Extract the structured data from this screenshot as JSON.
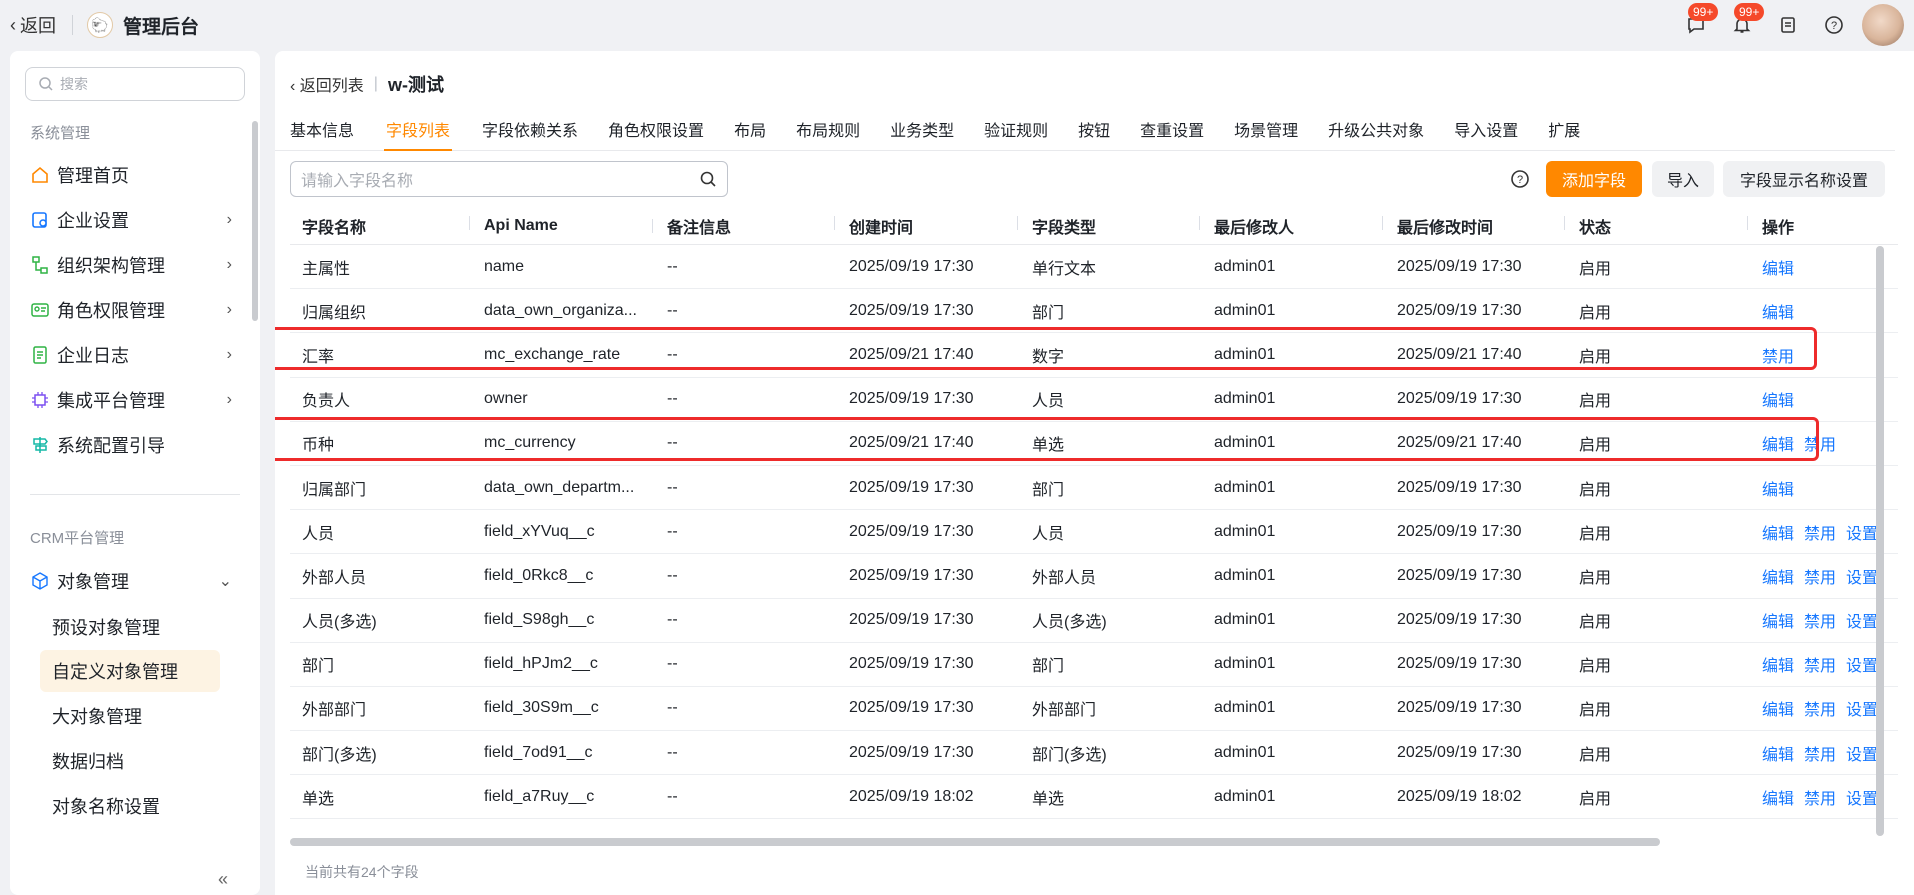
{
  "topbar": {
    "back_label": "返回",
    "app_title": "管理后台",
    "chat_badge": "99+",
    "bell_badge": "99+"
  },
  "sidebar": {
    "search_placeholder": "搜索",
    "group1_title": "系统管理",
    "items": [
      {
        "label": "管理首页"
      },
      {
        "label": "企业设置"
      },
      {
        "label": "组织架构管理"
      },
      {
        "label": "角色权限管理"
      },
      {
        "label": "企业日志"
      },
      {
        "label": "集成平台管理"
      },
      {
        "label": "系统配置引导"
      }
    ],
    "group2_title": "CRM平台管理",
    "object_menu": "对象管理",
    "sub_items": [
      {
        "label": "预设对象管理"
      },
      {
        "label": "自定义对象管理"
      },
      {
        "label": "大对象管理"
      },
      {
        "label": "数据归档"
      },
      {
        "label": "对象名称设置"
      }
    ],
    "collapse_icon": "«"
  },
  "main": {
    "back_list_label": "返回列表",
    "object_name": "w-测试",
    "tabs": [
      {
        "label": "基本信息"
      },
      {
        "label": "字段列表"
      },
      {
        "label": "字段依赖关系"
      },
      {
        "label": "角色权限设置"
      },
      {
        "label": "布局"
      },
      {
        "label": "布局规则"
      },
      {
        "label": "业务类型"
      },
      {
        "label": "验证规则"
      },
      {
        "label": "按钮"
      },
      {
        "label": "查重设置"
      },
      {
        "label": "场景管理"
      },
      {
        "label": "升级公共对象"
      },
      {
        "label": "导入设置"
      },
      {
        "label": "扩展"
      }
    ],
    "active_tab": "字段列表",
    "search_placeholder": "请输入字段名称",
    "add_field_button": "添加字段",
    "import_button": "导入",
    "display_name_button": "字段显示名称设置",
    "footer_text": "当前共有24个字段"
  },
  "table": {
    "columns": [
      "字段名称",
      "Api Name",
      "备注信息",
      "创建时间",
      "字段类型",
      "最后修改人",
      "最后修改时间",
      "状态",
      "操作"
    ],
    "rows": [
      {
        "name": "主属性",
        "api": "name",
        "note": "--",
        "created": "2025/09/19 17:30",
        "type": "单行文本",
        "modifier": "admin01",
        "modified": "2025/09/19 17:30",
        "status": "启用",
        "ops": [
          "编辑"
        ]
      },
      {
        "name": "归属组织",
        "api": "data_own_organiza...",
        "note": "--",
        "created": "2025/09/19 17:30",
        "type": "部门",
        "modifier": "admin01",
        "modified": "2025/09/19 17:30",
        "status": "启用",
        "ops": [
          "编辑"
        ]
      },
      {
        "name": "汇率",
        "api": "mc_exchange_rate",
        "note": "--",
        "created": "2025/09/21 17:40",
        "type": "数字",
        "modifier": "admin01",
        "modified": "2025/09/21 17:40",
        "status": "启用",
        "ops": [
          "禁用"
        ]
      },
      {
        "name": "负责人",
        "api": "owner",
        "note": "--",
        "created": "2025/09/19 17:30",
        "type": "人员",
        "modifier": "admin01",
        "modified": "2025/09/19 17:30",
        "status": "启用",
        "ops": [
          "编辑"
        ]
      },
      {
        "name": "币种",
        "api": "mc_currency",
        "note": "--",
        "created": "2025/09/21 17:40",
        "type": "单选",
        "modifier": "admin01",
        "modified": "2025/09/21 17:40",
        "status": "启用",
        "ops": [
          "编辑",
          "禁用"
        ]
      },
      {
        "name": "归属部门",
        "api": "data_own_departm...",
        "note": "--",
        "created": "2025/09/19 17:30",
        "type": "部门",
        "modifier": "admin01",
        "modified": "2025/09/19 17:30",
        "status": "启用",
        "ops": [
          "编辑"
        ]
      },
      {
        "name": "人员",
        "api": "field_xYVuq__c",
        "note": "--",
        "created": "2025/09/19 17:30",
        "type": "人员",
        "modifier": "admin01",
        "modified": "2025/09/19 17:30",
        "status": "启用",
        "ops": [
          "编辑",
          "禁用",
          "设置"
        ]
      },
      {
        "name": "外部人员",
        "api": "field_0Rkc8__c",
        "note": "--",
        "created": "2025/09/19 17:30",
        "type": "外部人员",
        "modifier": "admin01",
        "modified": "2025/09/19 17:30",
        "status": "启用",
        "ops": [
          "编辑",
          "禁用",
          "设置"
        ]
      },
      {
        "name": "人员(多选)",
        "api": "field_S98gh__c",
        "note": "--",
        "created": "2025/09/19 17:30",
        "type": "人员(多选)",
        "modifier": "admin01",
        "modified": "2025/09/19 17:30",
        "status": "启用",
        "ops": [
          "编辑",
          "禁用",
          "设置"
        ]
      },
      {
        "name": "部门",
        "api": "field_hPJm2__c",
        "note": "--",
        "created": "2025/09/19 17:30",
        "type": "部门",
        "modifier": "admin01",
        "modified": "2025/09/19 17:30",
        "status": "启用",
        "ops": [
          "编辑",
          "禁用",
          "设置"
        ]
      },
      {
        "name": "外部部门",
        "api": "field_30S9m__c",
        "note": "--",
        "created": "2025/09/19 17:30",
        "type": "外部部门",
        "modifier": "admin01",
        "modified": "2025/09/19 17:30",
        "status": "启用",
        "ops": [
          "编辑",
          "禁用",
          "设置"
        ]
      },
      {
        "name": "部门(多选)",
        "api": "field_7od91__c",
        "note": "--",
        "created": "2025/09/19 17:30",
        "type": "部门(多选)",
        "modifier": "admin01",
        "modified": "2025/09/19 17:30",
        "status": "启用",
        "ops": [
          "编辑",
          "禁用",
          "设置"
        ]
      },
      {
        "name": "单选",
        "api": "field_a7Ruy__c",
        "note": "--",
        "created": "2025/09/19 18:02",
        "type": "单选",
        "modifier": "admin01",
        "modified": "2025/09/19 18:02",
        "status": "启用",
        "ops": [
          "编辑",
          "禁用",
          "设置"
        ]
      }
    ]
  },
  "colors": {
    "accent": "#ff8800",
    "link": "#1677ff",
    "highlight": "#ee2b2b"
  }
}
